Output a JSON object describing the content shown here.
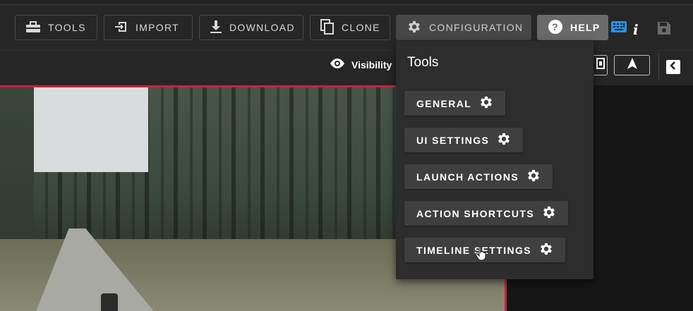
{
  "toolbar": {
    "tools_label": "TOOLS",
    "import_label": "IMPORT",
    "download_label": "DOWNLOAD",
    "clone_label": "CLONE",
    "configuration_label": "CONFIGURATION",
    "help_label": "HELP",
    "icons": [
      "toolbox-icon",
      "import-icon",
      "download-icon",
      "clone-icon",
      "gear-icon",
      "help-icon",
      "keyboard-icon",
      "info-icon",
      "save-icon"
    ]
  },
  "subbar": {
    "visibility_label": "Visibility",
    "icons": [
      "eye-icon",
      "fit-icon",
      "navigate-icon",
      "chevron-left-icon"
    ]
  },
  "menu": {
    "title": "Tools",
    "items": [
      {
        "label": "GENERAL",
        "icon": "gear-icon"
      },
      {
        "label": "UI SETTINGS",
        "icon": "gear-icon"
      },
      {
        "label": "LAUNCH ACTIONS",
        "icon": "gear-icon"
      },
      {
        "label": "ACTION SHORTCUTS",
        "icon": "gear-icon"
      },
      {
        "label": "TIMELINE SETTINGS",
        "icon": "gear-icon"
      }
    ]
  },
  "colors": {
    "accent_border": "#d01f3a",
    "keyboard_icon": "#2f8fe0",
    "menu_bg": "#2d2d2d",
    "menu_item_bg": "#3f3f3f"
  }
}
